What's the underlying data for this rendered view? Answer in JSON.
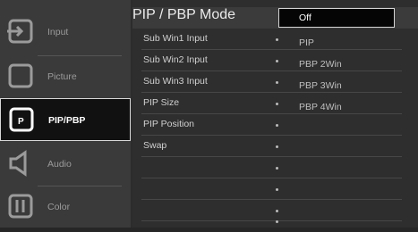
{
  "sidebar": {
    "items": [
      {
        "label": "Input",
        "icon": "input-icon"
      },
      {
        "label": "Picture",
        "icon": "picture-icon"
      },
      {
        "label": "PIP/PBP",
        "icon": "pip-icon",
        "icon_text": "P"
      },
      {
        "label": "Audio",
        "icon": "audio-icon"
      },
      {
        "label": "Color",
        "icon": "color-icon"
      }
    ]
  },
  "menu": {
    "rows": [
      {
        "label": "PIP / PBP Mode"
      },
      {
        "label": "Sub Win1 Input"
      },
      {
        "label": "Sub Win2 Input"
      },
      {
        "label": "Sub Win3 Input"
      },
      {
        "label": "PIP Size"
      },
      {
        "label": "PIP Position"
      },
      {
        "label": "Swap"
      }
    ]
  },
  "options": {
    "selected": "Off",
    "items": [
      "PIP",
      "PBP 2Win",
      "PBP 3Win",
      "PBP 4Win"
    ]
  },
  "colors": {
    "accent": "#ffffff",
    "panel": "#2e2e2e",
    "sidebar": "#3a3a3a"
  }
}
